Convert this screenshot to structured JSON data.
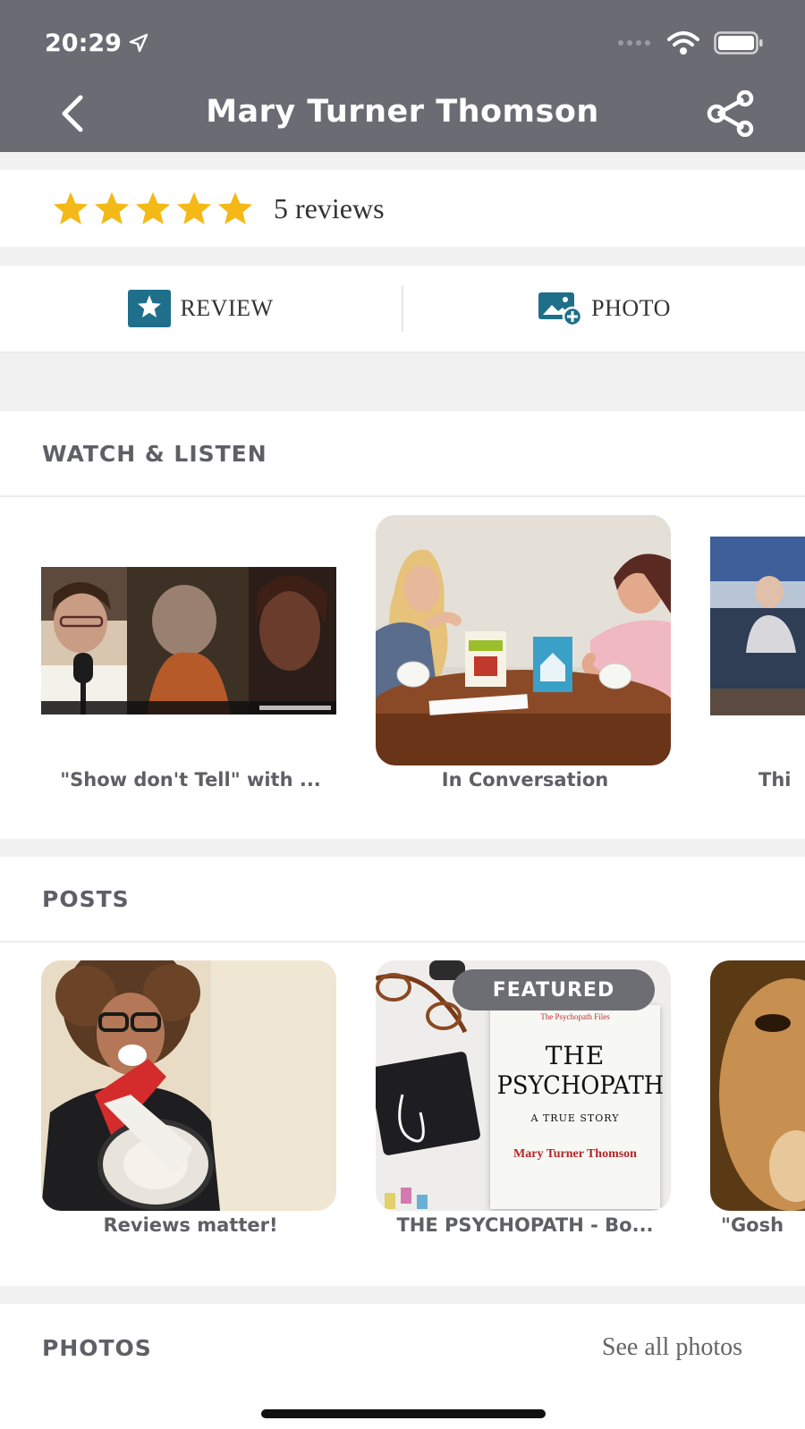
{
  "status_bar": {
    "time": "20:29"
  },
  "header": {
    "title": "Mary Turner Thomson"
  },
  "rating": {
    "stars": 5,
    "text": "5 reviews",
    "star_color": "#f4b916"
  },
  "actions": {
    "review_label": "REVIEW",
    "photo_label": "PHOTO",
    "icon_color": "#1f6f8b"
  },
  "watch": {
    "title": "WATCH & LISTEN",
    "items": [
      {
        "caption": "\"Show don't Tell\" with ..."
      },
      {
        "caption": "In Conversation"
      },
      {
        "caption": "Thi"
      }
    ]
  },
  "posts": {
    "title": "POSTS",
    "badge": "FEATURED",
    "items": [
      {
        "caption": "Reviews matter!"
      },
      {
        "caption": "THE PSYCHOPATH - Bo..."
      },
      {
        "caption": "\"Gosh"
      }
    ],
    "book": {
      "kicker": "The Psychopath Files",
      "title_line1": "THE",
      "title_line2": "PSYCHOPATH",
      "subtitle": "A TRUE STORY",
      "author": "Mary Turner Thomson"
    }
  },
  "photos": {
    "title": "PHOTOS",
    "see_all": "See all photos"
  }
}
